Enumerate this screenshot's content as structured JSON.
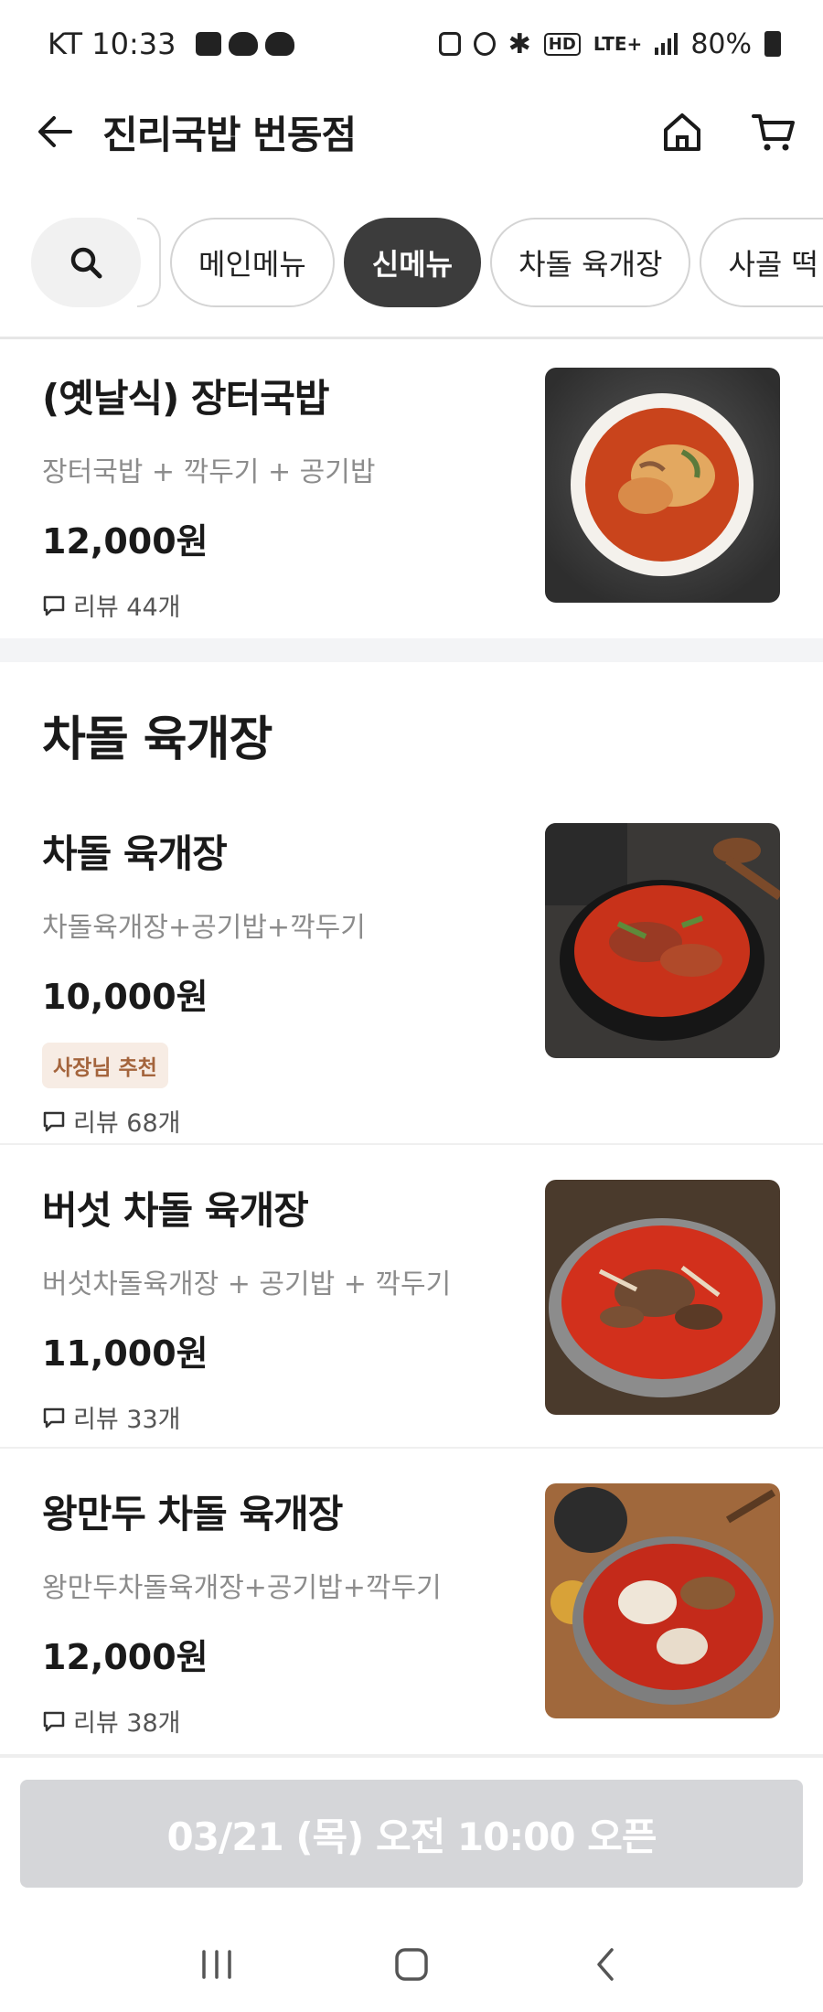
{
  "status_bar": {
    "carrier_time": "KT 10:33",
    "network": "LTE+",
    "hd": "HD",
    "battery": "80%"
  },
  "header": {
    "title": "진리국밥 번동점"
  },
  "categories": [
    "메인메뉴",
    "신메뉴",
    "차돌 육개장",
    "사골 떡 만"
  ],
  "active_category": "신메뉴",
  "top_item": {
    "name": "(옛날식) 장터국밥",
    "description": "장터국밥 + 깍두기 + 공기밥",
    "price": "12,000원",
    "review": "리뷰 44개"
  },
  "section": {
    "title": "차돌 육개장",
    "items": [
      {
        "name": "차돌 육개장",
        "description": "차돌육개장+공기밥+깍두기",
        "price": "10,000원",
        "badge": "사장님 추천",
        "review": "리뷰 68개"
      },
      {
        "name": "버섯 차돌 육개장",
        "description": "버섯차돌육개장 + 공기밥 + 깍두기",
        "price": "11,000원",
        "review": "리뷰 33개"
      },
      {
        "name": "왕만두 차돌 육개장",
        "description": "왕만두차돌육개장+공기밥+깍두기",
        "price": "12,000원",
        "review": "리뷰 38개"
      }
    ]
  },
  "open_button": "03/21 (목) 오전 10:00 오픈",
  "colors": {
    "active_chip": "#3c3c3c",
    "badge_bg": "#f7ece4",
    "badge_text": "#a4643c",
    "disabled_button": "#d5d6d9"
  }
}
